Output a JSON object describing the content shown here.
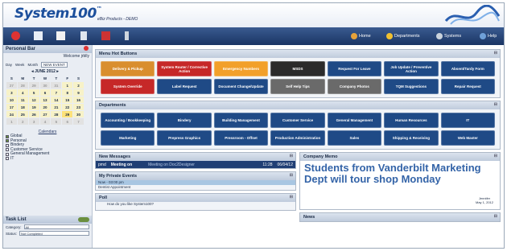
{
  "header": {
    "logo_text": "System100",
    "logo_tm": "™",
    "subtitle": "eBiz Products - DEMO"
  },
  "toolbar": {
    "icons": [
      "calendar-icon",
      "mail-icon",
      "schedule-icon",
      "document-icon",
      "chart-icon",
      "phone-icon"
    ],
    "nav": [
      {
        "label": "Home",
        "icon": "home-icon",
        "color": "#e6a23a"
      },
      {
        "label": "Departments",
        "icon": "departments-icon",
        "color": "#f0c030"
      },
      {
        "label": "Systems",
        "icon": "systems-icon",
        "color": "#c9d2dc"
      },
      {
        "label": "Help",
        "icon": "help-icon",
        "color": "#6fa0d8"
      }
    ]
  },
  "sidebar": {
    "title": "Personal Bar",
    "welcome": "Welcome jrblly",
    "views": [
      "Day",
      "Week",
      "Month"
    ],
    "new_event": "NEW EVENT",
    "calendar": {
      "month": "JUNE 2012",
      "prev": "◂",
      "next": "▸",
      "dow": [
        "S",
        "M",
        "T",
        "W",
        "T",
        "F",
        "S"
      ],
      "days": [
        {
          "d": "27",
          "out": true
        },
        {
          "d": "28",
          "out": true
        },
        {
          "d": "29",
          "out": true
        },
        {
          "d": "30",
          "out": true
        },
        {
          "d": "31",
          "out": true
        },
        {
          "d": "1"
        },
        {
          "d": "2"
        },
        {
          "d": "3"
        },
        {
          "d": "4"
        },
        {
          "d": "5"
        },
        {
          "d": "6"
        },
        {
          "d": "7"
        },
        {
          "d": "8"
        },
        {
          "d": "9"
        },
        {
          "d": "10"
        },
        {
          "d": "11"
        },
        {
          "d": "12"
        },
        {
          "d": "13"
        },
        {
          "d": "14"
        },
        {
          "d": "15"
        },
        {
          "d": "16"
        },
        {
          "d": "17"
        },
        {
          "d": "18"
        },
        {
          "d": "19"
        },
        {
          "d": "20"
        },
        {
          "d": "21"
        },
        {
          "d": "22"
        },
        {
          "d": "23"
        },
        {
          "d": "24"
        },
        {
          "d": "25"
        },
        {
          "d": "26"
        },
        {
          "d": "27"
        },
        {
          "d": "28"
        },
        {
          "d": "29",
          "today": true
        },
        {
          "d": "30"
        },
        {
          "d": "1",
          "out": true
        },
        {
          "d": "2",
          "out": true
        },
        {
          "d": "3",
          "out": true
        },
        {
          "d": "4",
          "out": true
        },
        {
          "d": "5",
          "out": true
        },
        {
          "d": "6",
          "out": true
        },
        {
          "d": "7",
          "out": true
        }
      ]
    },
    "calendars_label": "Calendars",
    "calendar_list": [
      {
        "label": "Global",
        "on": true
      },
      {
        "label": "Personal",
        "on": true
      },
      {
        "label": "Bindery",
        "on": false
      },
      {
        "label": "Customer Service",
        "on": false
      },
      {
        "label": "General Management",
        "on": false
      },
      {
        "label": "IT",
        "on": false
      }
    ],
    "tasklist": {
      "title": "Task List",
      "category_label": "Category:",
      "category_value": "All",
      "status_label": "Status:",
      "status_value": "Not Completed"
    }
  },
  "menu_hot_buttons": {
    "title": "Menu Hot Buttons",
    "buttons": [
      {
        "label": "Delivery & Pickup",
        "color": "#d98e2e"
      },
      {
        "label": "System Router / Corrective Action",
        "color": "#c62828"
      },
      {
        "label": "Emergency Numbers",
        "color": "#f2a02a"
      },
      {
        "label": "MSDS",
        "color": "#2b2b2b"
      },
      {
        "label": "Request For Leave",
        "color": "#1f4a86"
      },
      {
        "label": "Job Update / Preventive Action",
        "color": "#1f4a86"
      },
      {
        "label": "Absent/Tardy Form",
        "color": "#1f4a86"
      },
      {
        "label": "System Override",
        "color": "#c62828"
      },
      {
        "label": "Label Request",
        "color": "#1f4a86"
      },
      {
        "label": "Document Change/Update",
        "color": "#1f4a86"
      },
      {
        "label": "Self Help Tips",
        "color": "#6a6a6a"
      },
      {
        "label": "Company Photos",
        "color": "#6a6a6a"
      },
      {
        "label": "TQM Suggestions",
        "color": "#1f4a86"
      },
      {
        "label": "Repair Request",
        "color": "#1f4a86"
      }
    ]
  },
  "departments": {
    "title": "Departments",
    "buttons": [
      "Accounting / Bookkeeping",
      "Bindery",
      "Building Management",
      "Customer Service",
      "General Management",
      "Human Resources",
      "IT",
      "Marketing",
      "Prepress Graphics",
      "Pressroom - Offset",
      "Production Administration",
      "Sales",
      "Shipping & Receiving",
      "Web Master"
    ]
  },
  "new_messages": {
    "title": "New Messages",
    "row": {
      "from": "pmd",
      "subject": "Meeting on",
      "preview": "Meeting on Doc2Designer",
      "time": "11:28",
      "date": "06/04/12"
    }
  },
  "private_events": {
    "title": "My Private Events",
    "time": "Now - 03:00 pm",
    "event": "Dentist Appointment"
  },
  "poll": {
    "title": "Poll",
    "question": "How do you like System100?"
  },
  "company_memo": {
    "title": "Company Memo",
    "text": "Students from Vanderbilt Marketing Dept will tour shop Monday",
    "author": "Jennifer",
    "date": "May 1, 2012"
  },
  "news": {
    "title": "News"
  }
}
